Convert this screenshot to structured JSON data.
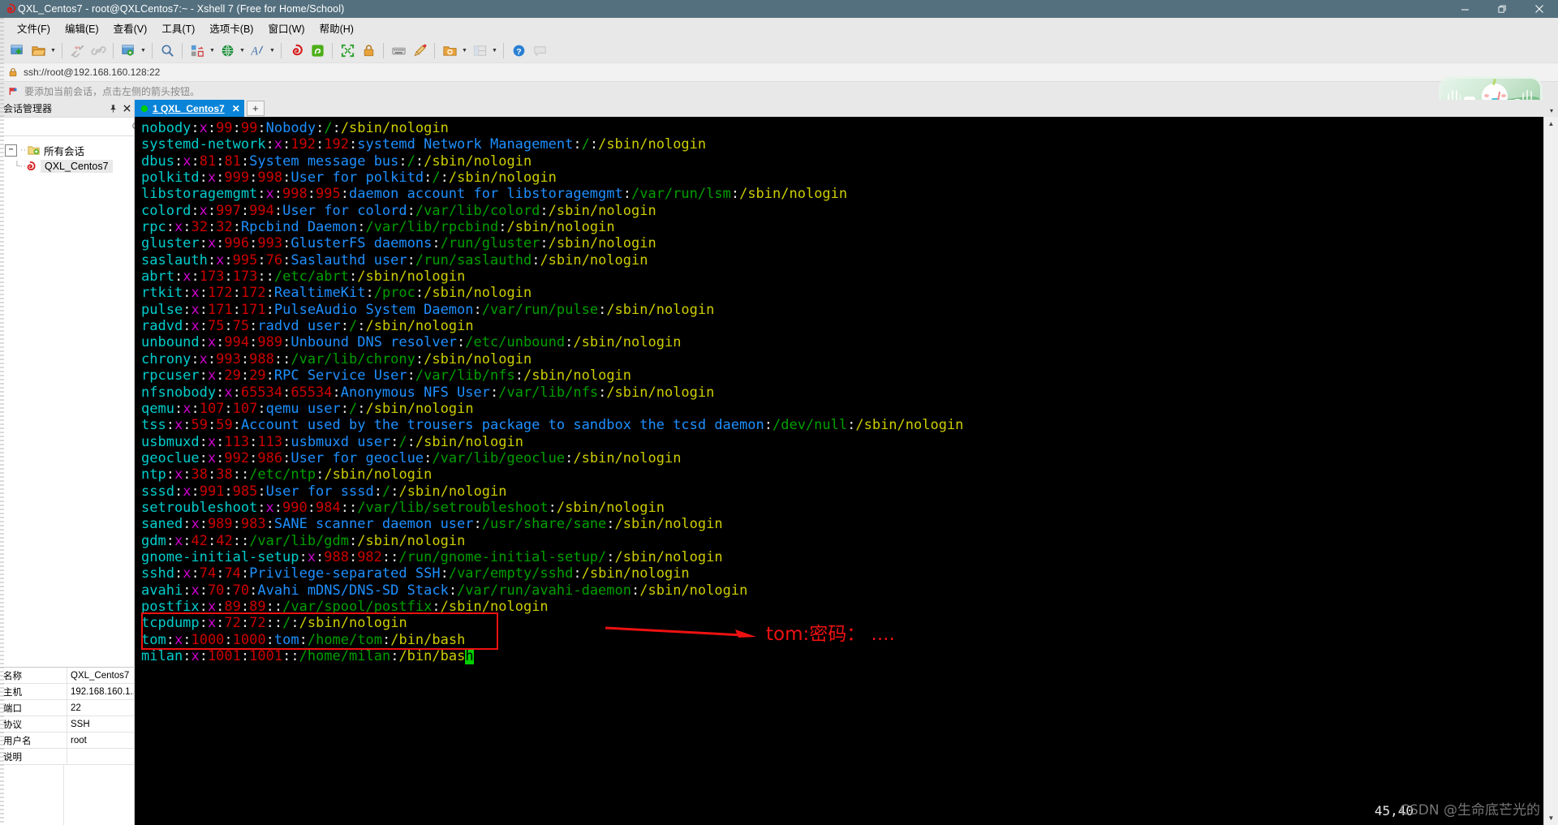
{
  "window": {
    "title": "QXL_Centos7 - root@QXLCentos7:~ - Xshell 7 (Free for Home/School)",
    "minimize_label": "—",
    "maximize_label": "❐",
    "close_label": "✕"
  },
  "menubar": {
    "items": [
      {
        "label": "文件(F)",
        "name": "menu-file"
      },
      {
        "label": "编辑(E)",
        "name": "menu-edit"
      },
      {
        "label": "查看(V)",
        "name": "menu-view"
      },
      {
        "label": "工具(T)",
        "name": "menu-tools"
      },
      {
        "label": "选项卡(B)",
        "name": "menu-tab"
      },
      {
        "label": "窗口(W)",
        "name": "menu-window"
      },
      {
        "label": "帮助(H)",
        "name": "menu-help"
      }
    ]
  },
  "address": {
    "value": "ssh://root@192.168.160.128:22",
    "icon": "lock-icon"
  },
  "hint": {
    "text": "要添加当前会话，点击左侧的箭头按钮。",
    "icon": "red-flag-icon"
  },
  "sidebar": {
    "title": "会话管理器",
    "pin_label": "⚐",
    "close_label": "✕",
    "search_placeholder": "",
    "search_value": "",
    "tree": {
      "root_label": "所有会话",
      "expander": "−",
      "children": [
        {
          "label": "QXL_Centos7",
          "selected": true
        }
      ]
    },
    "properties": [
      {
        "key": "名称",
        "value": "QXL_Centos7"
      },
      {
        "key": "主机",
        "value": "192.168.160.1..."
      },
      {
        "key": "端口",
        "value": "22"
      },
      {
        "key": "协议",
        "value": "SSH"
      },
      {
        "key": "用户名",
        "value": "root"
      },
      {
        "key": "说明",
        "value": ""
      }
    ]
  },
  "tabs": {
    "items": [
      {
        "label": "1 QXL_Centos7",
        "active": true,
        "status_color": "#00d000",
        "close_label": "✕"
      }
    ],
    "add_label": "+",
    "dropdown_label": "▾"
  },
  "toolbar": {
    "groups": [
      {
        "buttons": [
          {
            "name": "new-session-icon",
            "label": "",
            "has_arrow": false
          },
          {
            "name": "open-session-icon",
            "label": "",
            "has_arrow": true
          }
        ]
      },
      {
        "buttons": [
          {
            "name": "disconnect-icon",
            "label": "",
            "has_arrow": false
          },
          {
            "name": "reconnect-icon",
            "label": "",
            "has_arrow": false
          }
        ]
      },
      {
        "buttons": [
          {
            "name": "session-properties-icon",
            "label": "",
            "has_arrow": true
          }
        ]
      },
      {
        "buttons": [
          {
            "name": "find-icon",
            "label": "",
            "has_arrow": false
          }
        ]
      },
      {
        "buttons": [
          {
            "name": "layout-icon",
            "label": "",
            "has_arrow": true
          },
          {
            "name": "web-transfer-icon",
            "label": "",
            "has_arrow": true
          },
          {
            "name": "font-icon",
            "label": "",
            "has_arrow": true
          }
        ]
      },
      {
        "buttons": [
          {
            "name": "xshell-icon",
            "label": "",
            "has_arrow": false
          },
          {
            "name": "xftp-icon",
            "label": "",
            "has_arrow": false
          }
        ]
      },
      {
        "buttons": [
          {
            "name": "fullscreen-icon",
            "label": "",
            "has_arrow": false
          },
          {
            "name": "lock-session-icon",
            "label": "",
            "has_arrow": false
          }
        ]
      },
      {
        "buttons": [
          {
            "name": "keyboard-icon",
            "label": "",
            "has_arrow": false
          },
          {
            "name": "highlight-icon",
            "label": "",
            "has_arrow": false
          }
        ]
      },
      {
        "buttons": [
          {
            "name": "add-folder-icon",
            "label": "",
            "has_arrow": true
          },
          {
            "name": "split-view-icon",
            "label": "",
            "has_arrow": true
          }
        ]
      },
      {
        "buttons": [
          {
            "name": "help-icon",
            "label": "",
            "has_arrow": false
          },
          {
            "name": "feedback-icon",
            "label": "",
            "has_arrow": false
          }
        ]
      }
    ]
  },
  "terminal": {
    "cursor_position": "45,40",
    "lines": [
      {
        "user": "nobody",
        "x": "x",
        "uid": "99",
        "gid": "99",
        "gecos": "Nobody",
        "home": "/",
        "shell": "/sbin/nologin"
      },
      {
        "user": "systemd-network",
        "x": "x",
        "uid": "192",
        "gid": "192",
        "gecos": "systemd Network Management",
        "home": "/",
        "shell": "/sbin/nologin"
      },
      {
        "user": "dbus",
        "x": "x",
        "uid": "81",
        "gid": "81",
        "gecos": "System message bus",
        "home": "/",
        "shell": "/sbin/nologin"
      },
      {
        "user": "polkitd",
        "x": "x",
        "uid": "999",
        "gid": "998",
        "gecos": "User for polkitd",
        "home": "/",
        "shell": "/sbin/nologin"
      },
      {
        "user": "libstoragemgmt",
        "x": "x",
        "uid": "998",
        "gid": "995",
        "gecos": "daemon account for libstoragemgmt",
        "home": "/var/run/lsm",
        "shell": "/sbin/nologin"
      },
      {
        "user": "colord",
        "x": "x",
        "uid": "997",
        "gid": "994",
        "gecos": "User for colord",
        "home": "/var/lib/colord",
        "shell": "/sbin/nologin"
      },
      {
        "user": "rpc",
        "x": "x",
        "uid": "32",
        "gid": "32",
        "gecos": "Rpcbind Daemon",
        "home": "/var/lib/rpcbind",
        "shell": "/sbin/nologin"
      },
      {
        "user": "gluster",
        "x": "x",
        "uid": "996",
        "gid": "993",
        "gecos": "GlusterFS daemons",
        "home": "/run/gluster",
        "shell": "/sbin/nologin"
      },
      {
        "user": "saslauth",
        "x": "x",
        "uid": "995",
        "gid": "76",
        "gecos": "Saslauthd user",
        "home": "/run/saslauthd",
        "shell": "/sbin/nologin"
      },
      {
        "user": "abrt",
        "x": "x",
        "uid": "173",
        "gid": "173",
        "gecos": "",
        "home": "/etc/abrt",
        "shell": "/sbin/nologin"
      },
      {
        "user": "rtkit",
        "x": "x",
        "uid": "172",
        "gid": "172",
        "gecos": "RealtimeKit",
        "home": "/proc",
        "shell": "/sbin/nologin"
      },
      {
        "user": "pulse",
        "x": "x",
        "uid": "171",
        "gid": "171",
        "gecos": "PulseAudio System Daemon",
        "home": "/var/run/pulse",
        "shell": "/sbin/nologin"
      },
      {
        "user": "radvd",
        "x": "x",
        "uid": "75",
        "gid": "75",
        "gecos": "radvd user",
        "home": "/",
        "shell": "/sbin/nologin"
      },
      {
        "user": "unbound",
        "x": "x",
        "uid": "994",
        "gid": "989",
        "gecos": "Unbound DNS resolver",
        "home": "/etc/unbound",
        "shell": "/sbin/nologin"
      },
      {
        "user": "chrony",
        "x": "x",
        "uid": "993",
        "gid": "988",
        "gecos": "",
        "home": "/var/lib/chrony",
        "shell": "/sbin/nologin"
      },
      {
        "user": "rpcuser",
        "x": "x",
        "uid": "29",
        "gid": "29",
        "gecos": "RPC Service User",
        "home": "/var/lib/nfs",
        "shell": "/sbin/nologin"
      },
      {
        "user": "nfsnobody",
        "x": "x",
        "uid": "65534",
        "gid": "65534",
        "gecos": "Anonymous NFS User",
        "home": "/var/lib/nfs",
        "shell": "/sbin/nologin"
      },
      {
        "user": "qemu",
        "x": "x",
        "uid": "107",
        "gid": "107",
        "gecos": "qemu user",
        "home": "/",
        "shell": "/sbin/nologin"
      },
      {
        "user": "tss",
        "x": "x",
        "uid": "59",
        "gid": "59",
        "gecos": "Account used by the trousers package to sandbox the tcsd daemon",
        "home": "/dev/null",
        "shell": "/sbin/nologin"
      },
      {
        "user": "usbmuxd",
        "x": "x",
        "uid": "113",
        "gid": "113",
        "gecos": "usbmuxd user",
        "home": "/",
        "shell": "/sbin/nologin"
      },
      {
        "user": "geoclue",
        "x": "x",
        "uid": "992",
        "gid": "986",
        "gecos": "User for geoclue",
        "home": "/var/lib/geoclue",
        "shell": "/sbin/nologin"
      },
      {
        "user": "ntp",
        "x": "x",
        "uid": "38",
        "gid": "38",
        "gecos": "",
        "home": "/etc/ntp",
        "shell": "/sbin/nologin"
      },
      {
        "user": "sssd",
        "x": "x",
        "uid": "991",
        "gid": "985",
        "gecos": "User for sssd",
        "home": "/",
        "shell": "/sbin/nologin"
      },
      {
        "user": "setroubleshoot",
        "x": "x",
        "uid": "990",
        "gid": "984",
        "gecos": "",
        "home": "/var/lib/setroubleshoot",
        "shell": "/sbin/nologin"
      },
      {
        "user": "saned",
        "x": "x",
        "uid": "989",
        "gid": "983",
        "gecos": "SANE scanner daemon user",
        "home": "/usr/share/sane",
        "shell": "/sbin/nologin"
      },
      {
        "user": "gdm",
        "x": "x",
        "uid": "42",
        "gid": "42",
        "gecos": "",
        "home": "/var/lib/gdm",
        "shell": "/sbin/nologin"
      },
      {
        "user": "gnome-initial-setup",
        "x": "x",
        "uid": "988",
        "gid": "982",
        "gecos": "",
        "home": "/run/gnome-initial-setup/",
        "shell": "/sbin/nologin"
      },
      {
        "user": "sshd",
        "x": "x",
        "uid": "74",
        "gid": "74",
        "gecos": "Privilege-separated SSH",
        "home": "/var/empty/sshd",
        "shell": "/sbin/nologin"
      },
      {
        "user": "avahi",
        "x": "x",
        "uid": "70",
        "gid": "70",
        "gecos": "Avahi mDNS/DNS-SD Stack",
        "home": "/var/run/avahi-daemon",
        "shell": "/sbin/nologin"
      },
      {
        "user": "postfix",
        "x": "x",
        "uid": "89",
        "gid": "89",
        "gecos": "",
        "home": "/var/spool/postfix",
        "shell": "/sbin/nologin"
      },
      {
        "user": "tcpdump",
        "x": "x",
        "uid": "72",
        "gid": "72",
        "gecos": "",
        "home": "/",
        "shell": "/sbin/nologin"
      },
      {
        "user": "tom",
        "x": "x",
        "uid": "1000",
        "gid": "1000",
        "gecos": "tom",
        "home": "/home/tom",
        "shell": "/bin/bash",
        "boxed": true
      },
      {
        "user": "milan",
        "x": "x",
        "uid": "1001",
        "gid": "1001",
        "gecos": "",
        "home": "/home/milan",
        "shell": "/bin/bash",
        "boxed": true,
        "cursor_on_last": true
      }
    ]
  },
  "annotation": {
    "text": "tom:密码： ....",
    "color": "#ee1111"
  },
  "watermark": {
    "text": "CSDN @生命底芒光的"
  }
}
